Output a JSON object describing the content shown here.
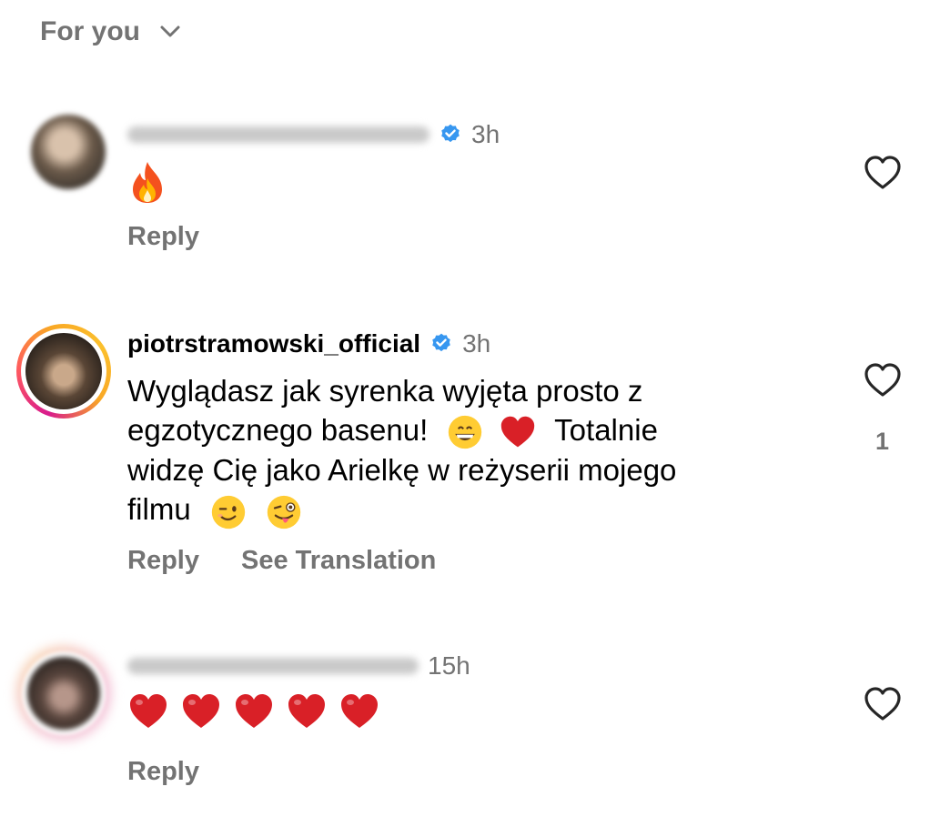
{
  "header": {
    "filter_label": "For you",
    "dropdown_icon": "chevron-down-icon"
  },
  "comments": [
    {
      "username": "",
      "username_hidden": true,
      "verified": true,
      "time": "3h",
      "text": "🔥",
      "actions": {
        "reply": "Reply"
      },
      "like_icon": "heart-outline-icon"
    },
    {
      "username": "piotrstramowski_official",
      "username_hidden": false,
      "verified": true,
      "time": "3h",
      "text_line1": "Wyglądasz jak syrenka wyjęta prosto z",
      "text_line2_a": "egzotycznego basenu!",
      "text_line2_b": "Totalnie",
      "text_line3": "widzę Cię jako Arielkę w reżyserii mojego",
      "text_line4": "filmu",
      "actions": {
        "reply": "Reply",
        "see_translation": "See Translation"
      },
      "like_icon": "heart-outline-icon",
      "like_count": "1",
      "story_ring": true
    },
    {
      "username": "",
      "username_hidden": true,
      "verified": false,
      "time": "15h",
      "text": "❤️❤️❤️❤️❤️",
      "actions": {
        "reply": "Reply"
      },
      "like_icon": "heart-outline-icon"
    }
  ],
  "colors": {
    "secondary_text": "#737373",
    "verified_blue": "#3797f0",
    "heart_red": "#d92027",
    "ring_start": "#f9a825",
    "ring_end": "#d81b8c"
  }
}
